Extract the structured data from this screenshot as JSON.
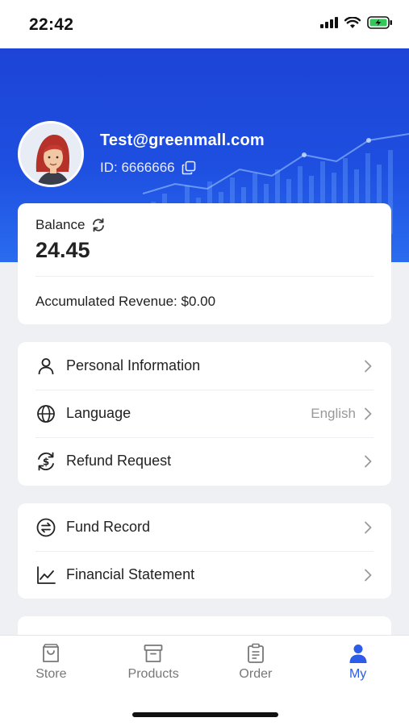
{
  "status_bar": {
    "time": "22:42",
    "icons": [
      "signal-icon",
      "wifi-icon",
      "battery-charging-icon"
    ]
  },
  "profile": {
    "email": "Test@greenmall.com",
    "id_text": "ID: 6666666"
  },
  "balance": {
    "label": "Balance",
    "value": "24.45",
    "revenue_text": "Accumulated Revenue: $0.00"
  },
  "menu_group_1": [
    {
      "label": "Personal Information",
      "icon": "person-icon",
      "value": ""
    },
    {
      "label": "Language",
      "icon": "globe-icon",
      "value": "English"
    },
    {
      "label": "Refund Request",
      "icon": "refund-icon",
      "value": ""
    }
  ],
  "menu_group_2": [
    {
      "label": "Fund Record",
      "icon": "exchange-icon",
      "value": ""
    },
    {
      "label": "Financial Statement",
      "icon": "chart-line-icon",
      "value": ""
    }
  ],
  "tabs": [
    {
      "label": "Store",
      "icon": "store-icon",
      "active": false
    },
    {
      "label": "Products",
      "icon": "box-icon",
      "active": false
    },
    {
      "label": "Order",
      "icon": "clipboard-icon",
      "active": false
    },
    {
      "label": "My",
      "icon": "user-icon",
      "active": true
    }
  ],
  "colors": {
    "hero": "#1e4fe0",
    "accent": "#2c5ce8",
    "background": "#eef0f4"
  }
}
